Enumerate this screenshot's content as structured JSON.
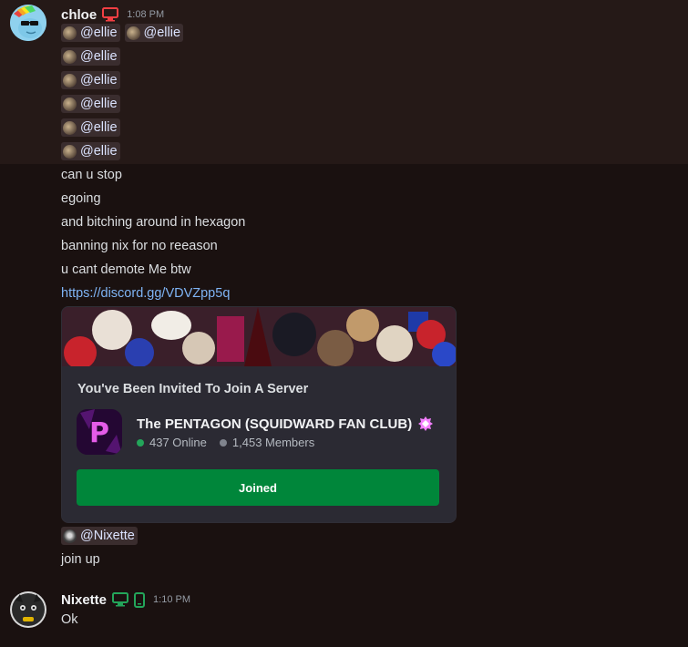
{
  "messages": [
    {
      "username": "chloe",
      "username_color": "#f2f3f5",
      "platform_icons": [
        "desktop-icon"
      ],
      "platform_color": "#f23f43",
      "timestamp": "1:08 PM",
      "lines": {
        "mention_user": "@ellie",
        "text1": "can u stop",
        "text2": "egoing",
        "text3": "and bitching around in hexagon",
        "text4": "banning nix for no reeason",
        "text5": "u cant demote Me btw",
        "link": "https://discord.gg/VDVZpp5q",
        "mention_nix": "@Nixette",
        "text6": "join up"
      },
      "invite": {
        "heading": "You've Been Invited To Join A Server",
        "server_name": "The PENTAGON (SQUIDWARD FAN CLUB)",
        "online": "437 Online",
        "members": "1,453 Members",
        "button_label": "Joined",
        "online_color": "#23a55a",
        "members_color": "#80848e",
        "button_color": "#00863a"
      }
    },
    {
      "username": "Nixette",
      "platform_icons": [
        "desktop-icon",
        "mobile-icon"
      ],
      "platform_color": "#23a55a",
      "timestamp": "1:10 PM",
      "text": "Ok"
    }
  ]
}
